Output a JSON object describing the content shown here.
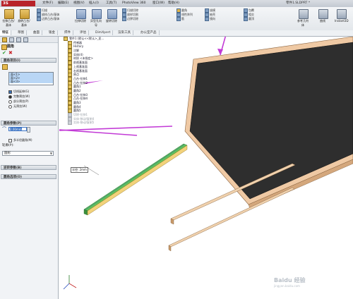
{
  "titlebar": {
    "logo": "3S SOLIDWORKS",
    "menus": [
      "文件(F)",
      "编辑(E)",
      "视图(V)",
      "插入(I)",
      "工具(T)",
      "PhotoView 360",
      "窗口(W)",
      "帮助(H)"
    ],
    "doc_title": "零件1.SLDPRT *"
  },
  "ribbon": {
    "col1": [
      "拉伸凸台/基体",
      "旋转凸台/基体"
    ],
    "col2": [
      "扫描",
      "放样凸台/基体",
      "边界凸台/基体"
    ],
    "col3": [
      "拉伸切除",
      "异型孔向导",
      "旋转切除"
    ],
    "col4": [
      "扫描切除",
      "放样切割",
      "边界切除"
    ],
    "col5": [
      "圆角",
      "线性阵列",
      "筋"
    ],
    "col6": [
      "拔模",
      "抽壳",
      "镜向"
    ],
    "col7": [
      "包覆",
      "相交",
      "圆顶"
    ],
    "col8": [
      "参考几何体",
      "曲线",
      "Instant3D"
    ]
  },
  "tabs": [
    "特征",
    "草图",
    "曲面",
    "钣金",
    "焊件",
    "评估",
    "DimXpert",
    "渲染工具",
    "办公室产品"
  ],
  "active_tab": "特征",
  "property_manager": {
    "title": "圆角",
    "items_header": "圆角项目(I)",
    "items": [
      "面<1>",
      "面<2>",
      "面<3>"
    ],
    "tangent_propagation": "切线延伸(G)",
    "preview_full": "完整预览(W)",
    "preview_partial": "部分预览(P)",
    "preview_none": "无预览(W)",
    "params_header": "圆角参数(P)",
    "radius_value": "2.00mm",
    "multi_radius": "多半径圆角(M)",
    "profile_label": "轮廓(P):",
    "profile_value": "圆形",
    "setback_header": "逆转参数(B)",
    "options_header": "圆角选项(O)"
  },
  "feature_tree": [
    {
      "label": "零件1 (默认<<默认>_显...",
      "ghost": false
    },
    {
      "label": "传感器",
      "ghost": false
    },
    {
      "label": "History",
      "ghost": false
    },
    {
      "label": "注解",
      "ghost": false
    },
    {
      "label": "实体(4)",
      "ghost": false
    },
    {
      "label": "材质 <未指定>",
      "ghost": false
    },
    {
      "label": "前视基准面",
      "ghost": false
    },
    {
      "label": "上视基准面",
      "ghost": false
    },
    {
      "label": "右视基准面",
      "ghost": false
    },
    {
      "label": "原点",
      "ghost": false
    },
    {
      "label": "凸台-拉伸1",
      "ghost": false
    },
    {
      "label": "凸台-拉伸2",
      "ghost": false
    },
    {
      "label": "圆角1",
      "ghost": false
    },
    {
      "label": "圆角2",
      "ghost": false
    },
    {
      "label": "凸台-拉伸3",
      "ghost": false
    },
    {
      "label": "凸台-拉伸4",
      "ghost": false
    },
    {
      "label": "圆角3",
      "ghost": false
    },
    {
      "label": "圆角4",
      "ghost": false
    },
    {
      "label": "圆角5",
      "ghost": false
    },
    {
      "label": "切除-拉伸1",
      "ghost": true
    },
    {
      "label": "实体-移动/复制4",
      "ghost": true
    },
    {
      "label": "实体-移动/复制5",
      "ghost": true
    }
  ],
  "viewport": {
    "dim_label": "半径: 2mm",
    "watermark": "Baidu 经验",
    "watermark_sub": "jingyan.baidu.com"
  },
  "colors": {
    "annotation_arrow": "#c23ad6",
    "panel_top": "#2b2b2b",
    "frame_edge": "#e8c9a0",
    "bar_green": "#49b34a"
  }
}
